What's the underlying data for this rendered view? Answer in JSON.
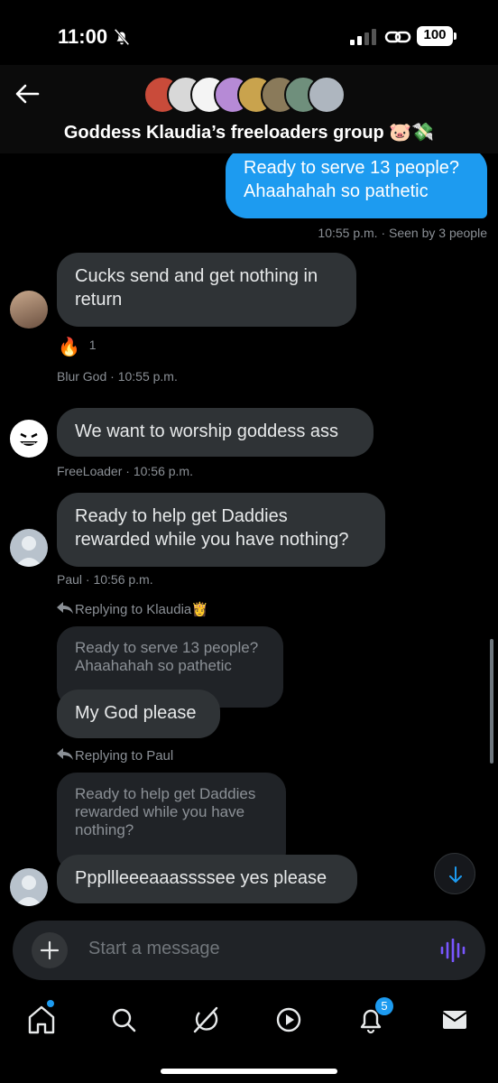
{
  "status_bar": {
    "time": "11:00",
    "battery": "100"
  },
  "header": {
    "title": "Goddess Klaudia’s freeloaders group 🐷💸"
  },
  "messages": [
    {
      "type": "outgoing",
      "text": "Ready to serve 13 people? Ahaahahah so pathetic",
      "meta": "10:55 p.m. · Seen by 3 people"
    },
    {
      "type": "incoming",
      "text": "Cucks send and get nothing in return",
      "reaction_emoji": "🔥",
      "reaction_count": "1",
      "meta": "Blur God · 10:55 p.m."
    },
    {
      "type": "incoming",
      "text": "We want to worship goddess ass",
      "meta": "FreeLoader · 10:56 p.m."
    },
    {
      "type": "incoming",
      "text": "Ready to help get Daddies rewarded while you have nothing?",
      "meta": "Paul · 10:56 p.m."
    },
    {
      "type": "incoming",
      "reply_label": "Replying to Klaudia👸",
      "quoted": "Ready to serve 13 people? Ahaahahah so pathetic",
      "text": "My God please"
    },
    {
      "type": "incoming",
      "reply_label": "Replying to Paul",
      "quoted": "Ready to help get Daddies rewarded while you have nothing?",
      "text": "Pppllleeeaaassssee yes please"
    }
  ],
  "composer": {
    "placeholder": "Start a message"
  },
  "bottom_nav": {
    "items": [
      "home-icon",
      "search-icon",
      "grok-icon",
      "video-icon",
      "notifications-icon",
      "messages-icon"
    ],
    "notifications_badge": "5"
  },
  "colors": {
    "accent": "#1d9bf0",
    "bubble_in": "#2f3336",
    "background": "#000000",
    "voice": "#7856ff"
  }
}
